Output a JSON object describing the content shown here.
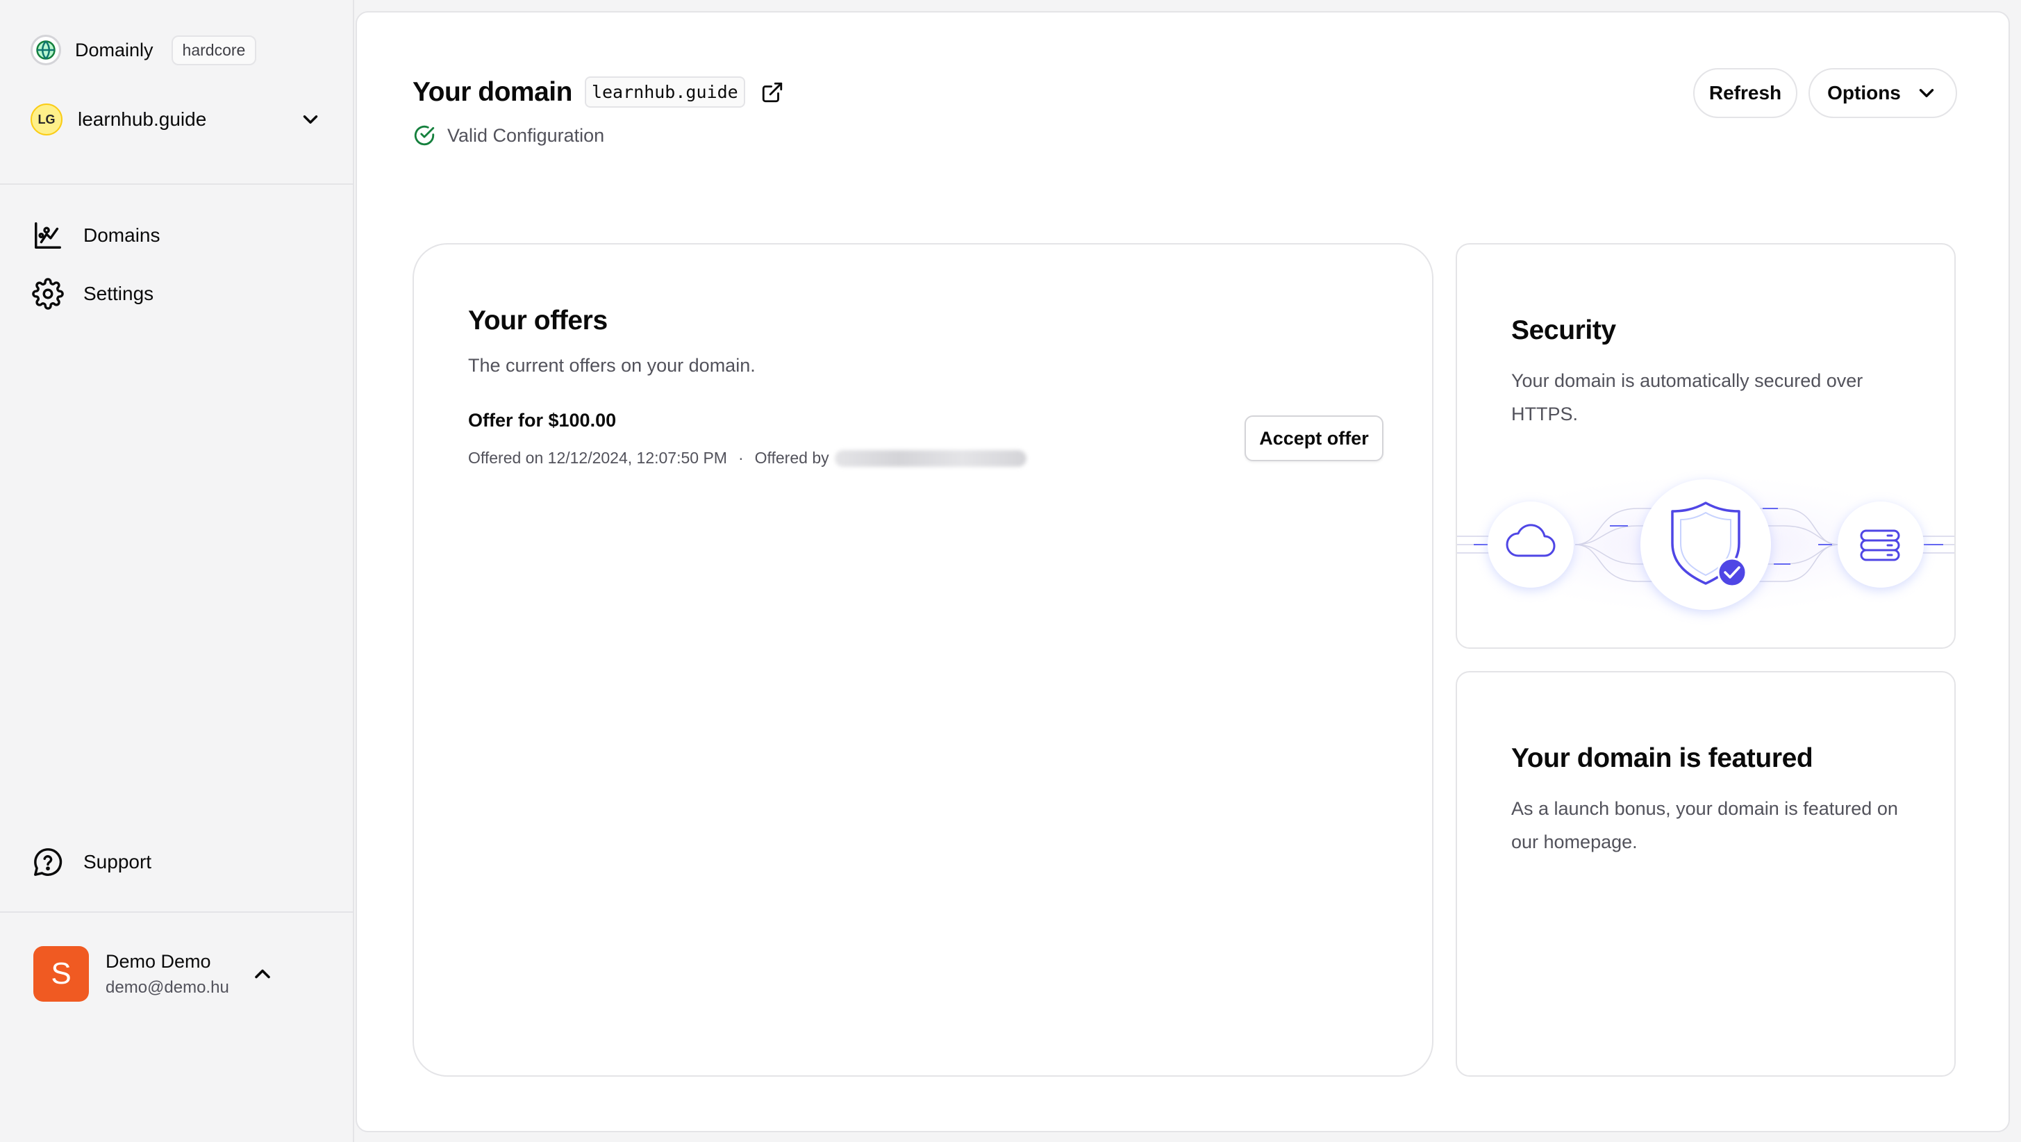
{
  "sidebar": {
    "app": {
      "name": "Domainly",
      "badge": "hardcore",
      "logo_icon": "globe-icon"
    },
    "domain_switcher": {
      "initials": "LG",
      "label": "learnhub.guide",
      "icon": "chevron-down-icon"
    },
    "nav": [
      {
        "label": "Domains",
        "icon": "chart-icon"
      },
      {
        "label": "Settings",
        "icon": "gear-icon"
      }
    ],
    "support": {
      "label": "Support",
      "icon": "help-bubble-icon"
    },
    "user": {
      "initial": "S",
      "name": "Demo Demo",
      "email": "demo@demo.hu",
      "icon": "chevron-up-icon"
    }
  },
  "header": {
    "title": "Your domain",
    "domain": "learnhub.guide",
    "status": "Valid Configuration",
    "refresh_label": "Refresh",
    "options_label": "Options"
  },
  "offers": {
    "title": "Your offers",
    "subtitle": "The current offers on your domain.",
    "items": [
      {
        "title": "Offer for $100.00",
        "offered_on": "Offered on 12/12/2024, 12:07:50 PM",
        "separator": "·",
        "offered_by": "Offered by",
        "accept_label": "Accept offer"
      }
    ]
  },
  "security": {
    "title": "Security",
    "description": "Your domain is automatically secured over HTTPS."
  },
  "featured": {
    "title": "Your domain is featured",
    "description": "As a launch bonus, your domain is featured on our homepage."
  },
  "colors": {
    "accent": "#4f46e5",
    "success": "#15803d",
    "user_avatar": "#f05a22",
    "domain_avatar": "#fef08a"
  }
}
